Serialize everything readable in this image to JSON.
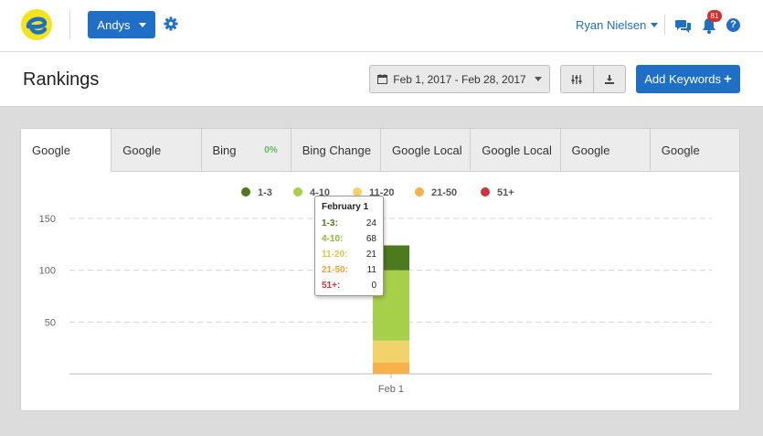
{
  "app": {
    "account_label": "Andys",
    "user_name": "Ryan Nielsen",
    "notification_count": "81",
    "help_glyph": "?",
    "accent_color": "#1f6fc7"
  },
  "page": {
    "title": "Rankings",
    "date_range": "Feb 1, 2017 - Feb 28, 2017",
    "add_keywords_label": "Add Keywords"
  },
  "tabs": [
    {
      "label": "Google",
      "active": true
    },
    {
      "label": "Google",
      "active": false
    },
    {
      "label": "Bing",
      "badge": "0%",
      "active": false
    },
    {
      "label": "Bing Change",
      "active": false
    },
    {
      "label": "Google Local",
      "active": false
    },
    {
      "label": "Google Local",
      "active": false
    },
    {
      "label": "Google",
      "active": false
    },
    {
      "label": "Google",
      "active": false
    }
  ],
  "chart_data": {
    "type": "bar",
    "stacked": true,
    "categories": [
      "Feb 1"
    ],
    "ylim": [
      0,
      150
    ],
    "yticks": [
      50,
      100,
      150
    ],
    "grid": true,
    "legend_position": "top",
    "series": [
      {
        "name": "1-3",
        "color": "#4e7a1f",
        "values": [
          24
        ]
      },
      {
        "name": "4-10",
        "color": "#a6d04a",
        "values": [
          68
        ]
      },
      {
        "name": "11-20",
        "color": "#f2d36b",
        "values": [
          21
        ]
      },
      {
        "name": "21-50",
        "color": "#f7b04a",
        "values": [
          11
        ]
      },
      {
        "name": "51+",
        "color": "#d0343a",
        "values": [
          0
        ]
      }
    ]
  },
  "tooltip": {
    "title": "February 1",
    "rows": [
      {
        "label": "1-3:",
        "value": "24",
        "color": "#4e7a1f"
      },
      {
        "label": "4-10:",
        "value": "68",
        "color": "#8dbb2f"
      },
      {
        "label": "11-20:",
        "value": "21",
        "color": "#e8c340"
      },
      {
        "label": "21-50:",
        "value": "11",
        "color": "#f0a030"
      },
      {
        "label": "51+:",
        "value": "0",
        "color": "#d0343a"
      }
    ]
  }
}
